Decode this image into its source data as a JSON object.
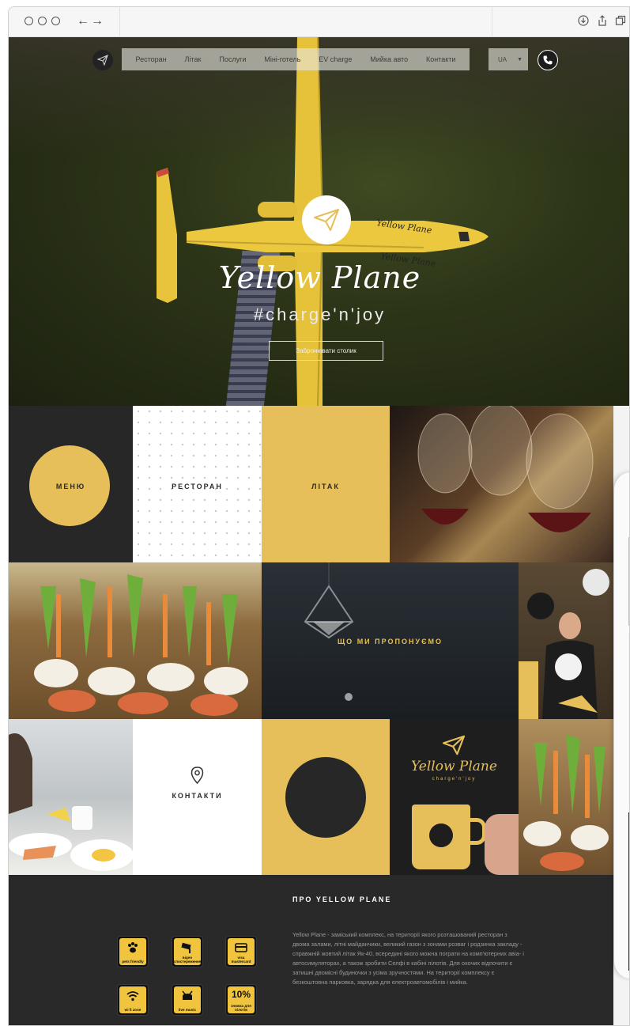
{
  "hero": {
    "nav": [
      "Ресторан",
      "Літак",
      "Послуги",
      "Міні-готель",
      "EV charge",
      "Мийка авто",
      "Контакти"
    ],
    "language": "UA",
    "title": "Yellow Plane",
    "tagline": "#charge'n'joy",
    "book_button": "Забронювати столик"
  },
  "tiles": {
    "menu": "МЕНЮ",
    "restaurant": "РЕСТОРАН",
    "plane": "ЛІТАК",
    "offer": "ЩО МИ ПРОПОНУЄМО",
    "contacts": "КОНТАКТИ"
  },
  "mug": {
    "brand": "Yellow Plane",
    "tagline": "charge'n'joy"
  },
  "about": {
    "title": "ПРО YELLOW PLANE",
    "text": "Yellow Plane - заміський комплекс, на території якого розташований ресторан з двома залами, літні майданчики, великий газон з зонами розваг і родзинка закладу - справжній жовтий літак Як-40, всередині якого можна пограти на комп'ютерних авіа- і автосимуляторах, а також зробити Селфі в кабіні пілотів. Для охочих відпочити є затишні двомісні будиночки з усіма зручностями. На території комплексу є безкоштовна парковка, зарядка для електроавтомобілів і мийка.",
    "badges": [
      {
        "icon": "paw-icon",
        "label": "pets friendly"
      },
      {
        "icon": "camera-icon",
        "label": "відео спостереження"
      },
      {
        "icon": "card-icon",
        "label": "visa mastercard"
      },
      {
        "icon": "wifi-icon",
        "label": "wi fi zone"
      },
      {
        "icon": "drums-icon",
        "label": "live music"
      },
      {
        "icon": "discount-icon",
        "label": "знижка для пілотів",
        "value": "10%"
      }
    ]
  },
  "colors": {
    "accent_yellow": "#e6bf5a",
    "dark": "#272727"
  }
}
